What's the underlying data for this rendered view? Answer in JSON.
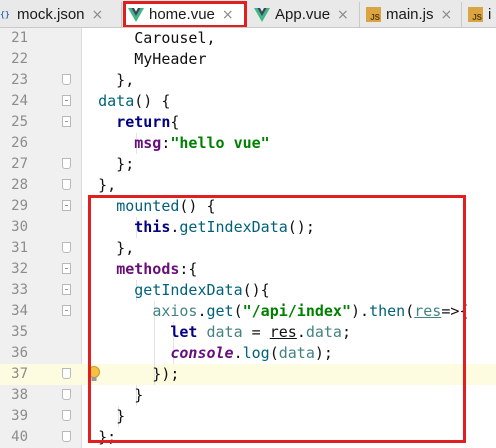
{
  "tabs": [
    {
      "label": "mock.json",
      "icon": "json-file-icon"
    },
    {
      "label": "home.vue",
      "icon": "vue-file-icon",
      "active": true
    },
    {
      "label": "App.vue",
      "icon": "vue-file-icon"
    },
    {
      "label": "main.js",
      "icon": "js-file-icon"
    },
    {
      "label": "i",
      "icon": "js-file-icon"
    }
  ],
  "tab_close_glyph": "×",
  "json_icon_text": "{}",
  "js_icon_text": "JS",
  "colors": {
    "highlight": "#e02020",
    "vue_green": "#41b883",
    "vue_dark": "#35495e",
    "keyword": "#000080",
    "string": "#008000",
    "property": "#660e7a"
  },
  "editor": {
    "current_line": 37,
    "lines": [
      {
        "num": "21",
        "tokens": [
          {
            "t": "        Carousel,",
            "c": "plain"
          }
        ]
      },
      {
        "num": "22",
        "tokens": [
          {
            "t": "        MyHeader",
            "c": "plain"
          }
        ]
      },
      {
        "num": "23",
        "tokens": [
          {
            "t": "      },",
            "c": "plain"
          }
        ]
      },
      {
        "num": "24",
        "tokens": [
          {
            "t": "    ",
            "c": "plain"
          },
          {
            "t": "data",
            "c": "fn"
          },
          {
            "t": "() {",
            "c": "plain"
          }
        ]
      },
      {
        "num": "25",
        "tokens": [
          {
            "t": "      ",
            "c": "plain"
          },
          {
            "t": "return",
            "c": "kw"
          },
          {
            "t": "{",
            "c": "plain"
          }
        ]
      },
      {
        "num": "26",
        "tokens": [
          {
            "t": "        ",
            "c": "plain"
          },
          {
            "t": "msg",
            "c": "prop"
          },
          {
            "t": ":",
            "c": "plain"
          },
          {
            "t": "\"hello vue\"",
            "c": "str"
          }
        ]
      },
      {
        "num": "27",
        "tokens": [
          {
            "t": "      };",
            "c": "plain"
          }
        ]
      },
      {
        "num": "28",
        "tokens": [
          {
            "t": "    },",
            "c": "plain"
          }
        ]
      },
      {
        "num": "29",
        "tokens": [
          {
            "t": "      ",
            "c": "plain"
          },
          {
            "t": "mounted",
            "c": "fn"
          },
          {
            "t": "() {",
            "c": "plain"
          }
        ]
      },
      {
        "num": "30",
        "tokens": [
          {
            "t": "        ",
            "c": "plain"
          },
          {
            "t": "this",
            "c": "kw"
          },
          {
            "t": ".",
            "c": "plain"
          },
          {
            "t": "getIndexData",
            "c": "fn"
          },
          {
            "t": "();",
            "c": "plain"
          }
        ]
      },
      {
        "num": "31",
        "tokens": [
          {
            "t": "      },",
            "c": "plain"
          }
        ]
      },
      {
        "num": "32",
        "tokens": [
          {
            "t": "      ",
            "c": "plain"
          },
          {
            "t": "methods",
            "c": "prop"
          },
          {
            "t": ":{",
            "c": "plain"
          }
        ]
      },
      {
        "num": "33",
        "tokens": [
          {
            "t": "        ",
            "c": "plain"
          },
          {
            "t": "getIndexData",
            "c": "fn"
          },
          {
            "t": "(){",
            "c": "plain"
          }
        ]
      },
      {
        "num": "34",
        "tokens": [
          {
            "t": "          ",
            "c": "plain"
          },
          {
            "t": "axios",
            "c": "var"
          },
          {
            "t": ".",
            "c": "plain"
          },
          {
            "t": "get",
            "c": "fn"
          },
          {
            "t": "(",
            "c": "plain"
          },
          {
            "t": "\"/api/index\"",
            "c": "str"
          },
          {
            "t": ").",
            "c": "plain"
          },
          {
            "t": "then",
            "c": "fn"
          },
          {
            "t": "(",
            "c": "plain"
          },
          {
            "t": "res",
            "c": "var ul"
          },
          {
            "t": "=>{",
            "c": "plain"
          }
        ]
      },
      {
        "num": "35",
        "tokens": [
          {
            "t": "            ",
            "c": "plain"
          },
          {
            "t": "let",
            "c": "kw"
          },
          {
            "t": " ",
            "c": "plain"
          },
          {
            "t": "data",
            "c": "var"
          },
          {
            "t": " = ",
            "c": "plain"
          },
          {
            "t": "res",
            "c": "plain ul"
          },
          {
            "t": ".",
            "c": "plain"
          },
          {
            "t": "data",
            "c": "var"
          },
          {
            "t": ";",
            "c": "plain"
          }
        ]
      },
      {
        "num": "36",
        "tokens": [
          {
            "t": "            ",
            "c": "plain"
          },
          {
            "t": "console",
            "c": "it"
          },
          {
            "t": ".",
            "c": "plain"
          },
          {
            "t": "log",
            "c": "fn"
          },
          {
            "t": "(",
            "c": "plain"
          },
          {
            "t": "data",
            "c": "var"
          },
          {
            "t": ");",
            "c": "plain"
          }
        ]
      },
      {
        "num": "37",
        "tokens": [
          {
            "t": "          });",
            "c": "plain"
          }
        ]
      },
      {
        "num": "38",
        "tokens": [
          {
            "t": "        }",
            "c": "plain"
          }
        ]
      },
      {
        "num": "39",
        "tokens": [
          {
            "t": "      }",
            "c": "plain"
          }
        ]
      },
      {
        "num": "40",
        "tokens": [
          {
            "t": "    };",
            "c": "plain"
          }
        ]
      }
    ]
  }
}
